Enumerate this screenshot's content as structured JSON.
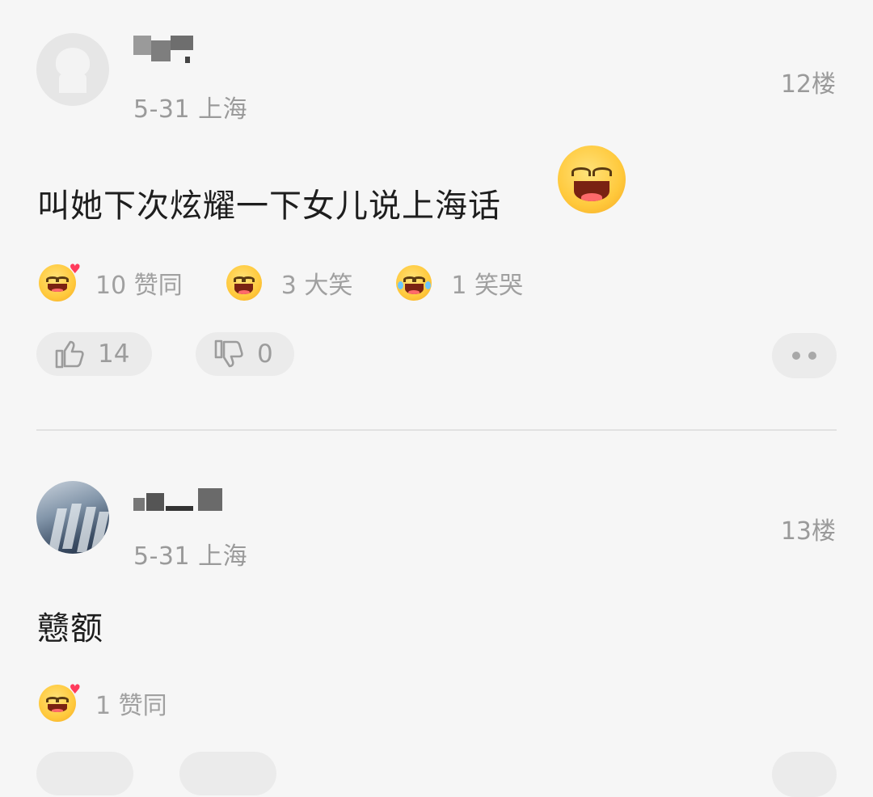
{
  "comments": [
    {
      "date_location": "5-31 上海",
      "floor": "12楼",
      "text": "叫她下次炫耀一下女儿说上海话",
      "reactions": [
        {
          "icon": "heart-eyes-emoji-icon",
          "count_label": "10 赞同"
        },
        {
          "icon": "laugh-emoji-icon",
          "count_label": "3 大笑"
        },
        {
          "icon": "crying-laugh-emoji-icon",
          "count_label": "1 笑哭"
        }
      ],
      "likes": "14",
      "dislikes": "0"
    },
    {
      "date_location": "5-31 上海",
      "floor": "13楼",
      "text": "戆额",
      "reactions": [
        {
          "icon": "heart-eyes-emoji-icon",
          "count_label": "1 赞同"
        }
      ]
    }
  ],
  "colors": {
    "background": "#f6f6f6",
    "muted_text": "#9a9a9a",
    "pill_bg": "#ebebeb"
  }
}
